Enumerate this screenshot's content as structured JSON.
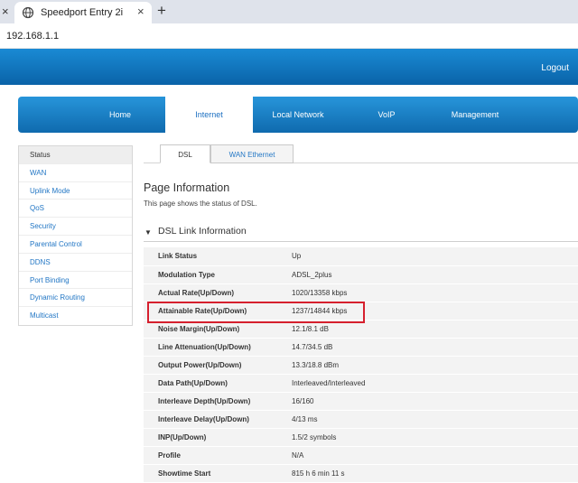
{
  "browser": {
    "tab_title": "Speedport Entry 2i",
    "tab_close_glyph": "×",
    "left_close_glyph": "×",
    "new_tab_glyph": "+",
    "url": "192.168.1.1",
    "tab_icon": "globe-icon"
  },
  "header": {
    "logout": "Logout"
  },
  "main_nav": {
    "items": [
      "Home",
      "Internet",
      "Local Network",
      "VoIP",
      "Management"
    ],
    "active": "Internet"
  },
  "side_menu": {
    "items": [
      "Status",
      "WAN",
      "Uplink Mode",
      "QoS",
      "Security",
      "Parental Control",
      "DDNS",
      "Port Binding",
      "Dynamic Routing",
      "Multicast"
    ],
    "active": "Status"
  },
  "sub_tabs": {
    "items": [
      "DSL",
      "WAN Ethernet"
    ],
    "active": "DSL"
  },
  "page": {
    "title": "Page Information",
    "description": "This page shows the status of DSL.",
    "section_title": "DSL Link Information",
    "section_arrow": "▼"
  },
  "dsl_info": {
    "rows": [
      {
        "label": "Link Status",
        "value": "Up"
      },
      {
        "label": "Modulation Type",
        "value": "ADSL_2plus"
      },
      {
        "label": "Actual Rate(Up/Down)",
        "value": "1020/13358 kbps"
      },
      {
        "label": "Attainable Rate(Up/Down)",
        "value": "1237/14844 kbps"
      },
      {
        "label": "Noise Margin(Up/Down)",
        "value": "12.1/8.1 dB"
      },
      {
        "label": "Line Attenuation(Up/Down)",
        "value": "14.7/34.5 dB"
      },
      {
        "label": "Output Power(Up/Down)",
        "value": "13.3/18.8 dBm"
      },
      {
        "label": "Data Path(Up/Down)",
        "value": "Interleaved/Interleaved"
      },
      {
        "label": "Interleave Depth(Up/Down)",
        "value": "16/160"
      },
      {
        "label": "Interleave Delay(Up/Down)",
        "value": "4/13 ms"
      },
      {
        "label": "INP(Up/Down)",
        "value": "1.5/2 symbols"
      },
      {
        "label": "Profile",
        "value": "N/A"
      },
      {
        "label": "Showtime Start",
        "value": "815 h 6 min 11 s"
      }
    ]
  },
  "colors": {
    "header_blue": "#0a63a8",
    "link_blue": "#2377c5",
    "highlight_red": "#d6202e"
  }
}
